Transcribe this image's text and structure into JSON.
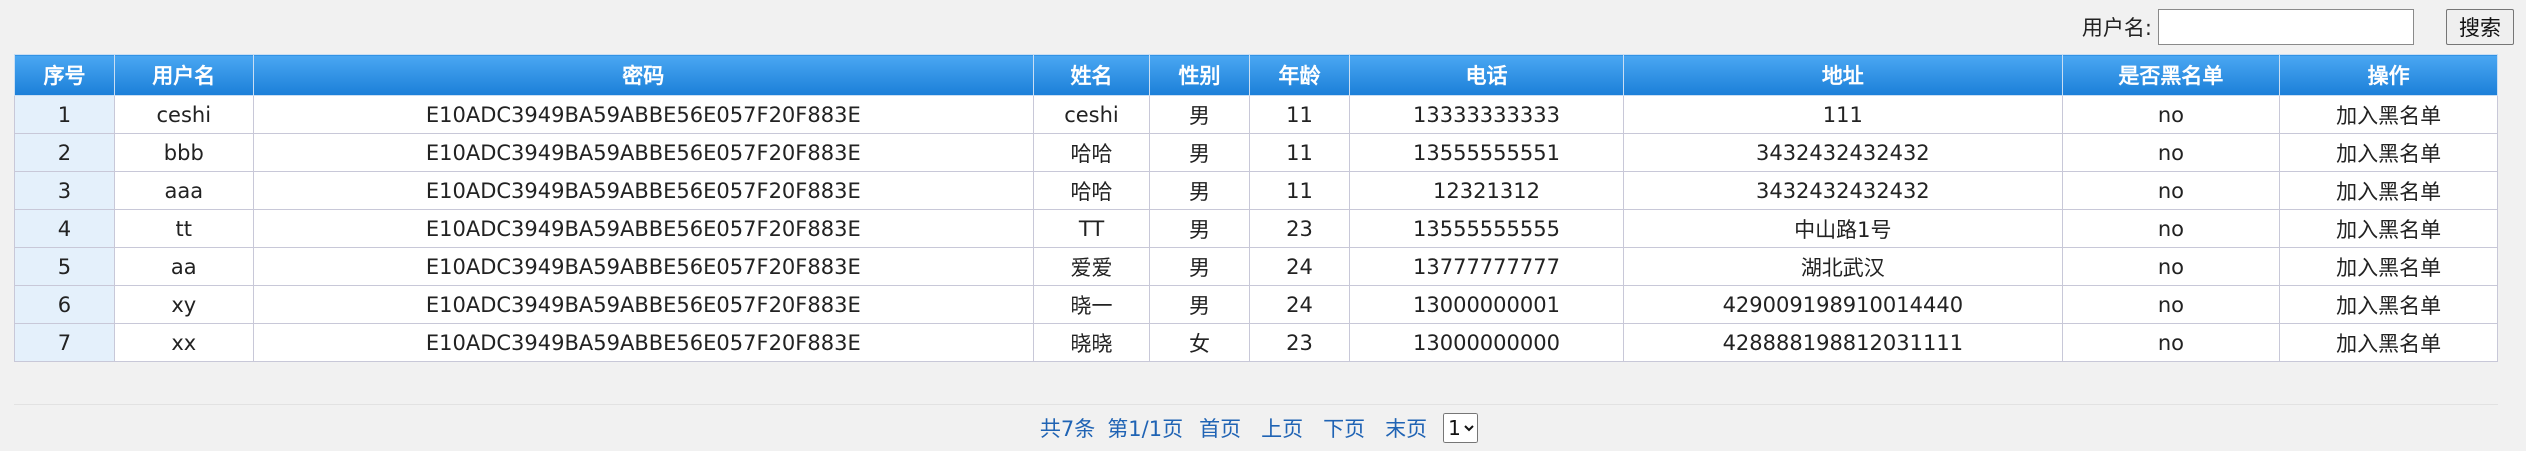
{
  "search": {
    "label": "用户名:",
    "value": "",
    "placeholder": "",
    "button_label": "搜索"
  },
  "table": {
    "headers": [
      "序号",
      "用户名",
      "密码",
      "姓名",
      "性别",
      "年龄",
      "电话",
      "地址",
      "是否黑名单",
      "操作"
    ],
    "rows": [
      [
        "1",
        "ceshi",
        "E10ADC3949BA59ABBE56E057F20F883E",
        "ceshi",
        "男",
        "11",
        "13333333333",
        "111",
        "no",
        "加入黑名单"
      ],
      [
        "2",
        "bbb",
        "E10ADC3949BA59ABBE56E057F20F883E",
        "哈哈",
        "男",
        "11",
        "13555555551",
        "3432432432432",
        "no",
        "加入黑名单"
      ],
      [
        "3",
        "aaa",
        "E10ADC3949BA59ABBE56E057F20F883E",
        "哈哈",
        "男",
        "11",
        "12321312",
        "3432432432432",
        "no",
        "加入黑名单"
      ],
      [
        "4",
        "tt",
        "E10ADC3949BA59ABBE56E057F20F883E",
        "TT",
        "男",
        "23",
        "13555555555",
        "中山路1号",
        "no",
        "加入黑名单"
      ],
      [
        "5",
        "aa",
        "E10ADC3949BA59ABBE56E057F20F883E",
        "爱爱",
        "男",
        "24",
        "13777777777",
        "湖北武汉",
        "no",
        "加入黑名单"
      ],
      [
        "6",
        "xy",
        "E10ADC3949BA59ABBE56E057F20F883E",
        "晓一",
        "男",
        "24",
        "13000000001",
        "429009198910014440",
        "no",
        "加入黑名单"
      ],
      [
        "7",
        "xx",
        "E10ADC3949BA59ABBE56E057F20F883E",
        "晓晓",
        "女",
        "23",
        "13000000000",
        "428888198812031111",
        "no",
        "加入黑名单"
      ]
    ]
  },
  "pager": {
    "total": "共7条",
    "page_info": "第1/1页",
    "first": "首页",
    "prev": "上页",
    "next": "下页",
    "last": "末页",
    "selected_page": "1"
  }
}
